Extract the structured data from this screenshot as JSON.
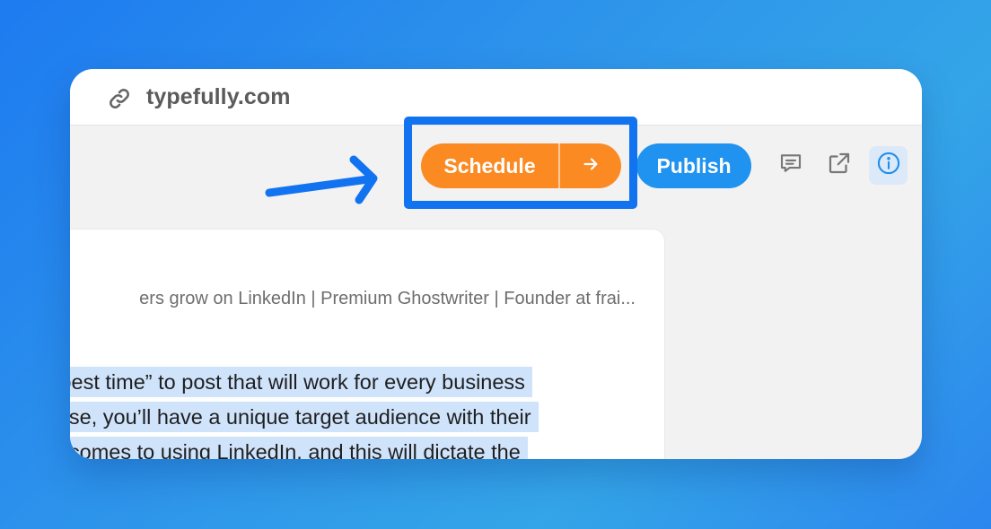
{
  "browser": {
    "url": "typefully.com",
    "link_icon": "link-icon"
  },
  "toolbar": {
    "schedule_label": "Schedule",
    "schedule_arrow_icon": "arrow-right-icon",
    "publish_label": "Publish",
    "icons": [
      "comment-icon",
      "external-link-icon",
      "info-icon"
    ],
    "schedule_color": "#fb8a22",
    "publish_color": "#1f93ef"
  },
  "annotation": {
    "arrow_color": "#1173f0",
    "box_color": "#1173f0"
  },
  "post": {
    "bio": "ers grow on LinkedIn | Premium Ghostwriter | Founder at frai...",
    "lines": [
      "e “best time” to post that will work for every business",
      "e else, you’ll have a unique target audience with their",
      "n it comes to using LinkedIn, and this will dictate the"
    ]
  }
}
